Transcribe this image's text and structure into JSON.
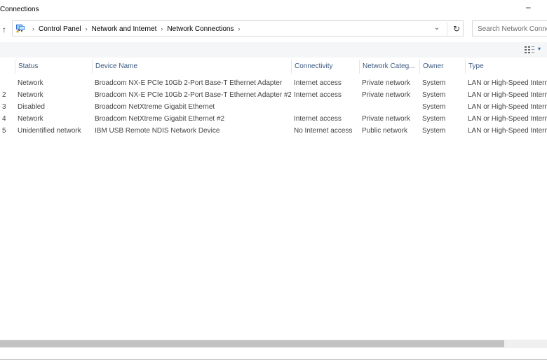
{
  "window": {
    "title": "Connections",
    "minimize_glyph": "–"
  },
  "address": {
    "icon": "network-places-icon",
    "breadcrumbs": [
      {
        "label": "Control Panel"
      },
      {
        "label": "Network and Internet"
      },
      {
        "label": "Network Connections"
      }
    ],
    "separator": "›",
    "trailing_separator": "›",
    "dropdown_glyph": "⌄",
    "refresh_glyph": "↻",
    "up_glyph": "↑"
  },
  "search": {
    "placeholder": "Search Network Connections"
  },
  "toolbar": {
    "view_glyph": "▾"
  },
  "columns": [
    {
      "label": ""
    },
    {
      "label": "Status"
    },
    {
      "label": "Device Name"
    },
    {
      "label": "Connectivity"
    },
    {
      "label": "Network Categ..."
    },
    {
      "label": "Owner"
    },
    {
      "label": "Type"
    }
  ],
  "rows": [
    {
      "name": "",
      "status": "Network",
      "device": "Broadcom NX-E PCIe 10Gb 2-Port Base-T Ethernet Adapter",
      "connectivity": "Internet access",
      "category": "Private network",
      "owner": "System",
      "type": "LAN or High-Speed Internet"
    },
    {
      "name": "2",
      "status": "Network",
      "device": "Broadcom NX-E PCIe 10Gb 2-Port Base-T Ethernet Adapter #2",
      "connectivity": "Internet access",
      "category": "Private network",
      "owner": "System",
      "type": "LAN or High-Speed Internet"
    },
    {
      "name": "3",
      "status": "Disabled",
      "device": "Broadcom NetXtreme Gigabit Ethernet",
      "connectivity": "",
      "category": "",
      "owner": "System",
      "type": "LAN or High-Speed Internet"
    },
    {
      "name": "4",
      "status": "Network",
      "device": "Broadcom NetXtreme Gigabit Ethernet #2",
      "connectivity": "Internet access",
      "category": "Private network",
      "owner": "System",
      "type": "LAN or High-Speed Internet"
    },
    {
      "name": "5",
      "status": "Unidentified network",
      "device": "IBM USB Remote NDIS Network Device",
      "connectivity": "No Internet access",
      "category": "Public network",
      "owner": "System",
      "type": "LAN or High-Speed Internet"
    }
  ],
  "colors": {
    "header_text": "#3c5a80",
    "cell_text": "#444444",
    "accent": "#1f5fbf"
  }
}
